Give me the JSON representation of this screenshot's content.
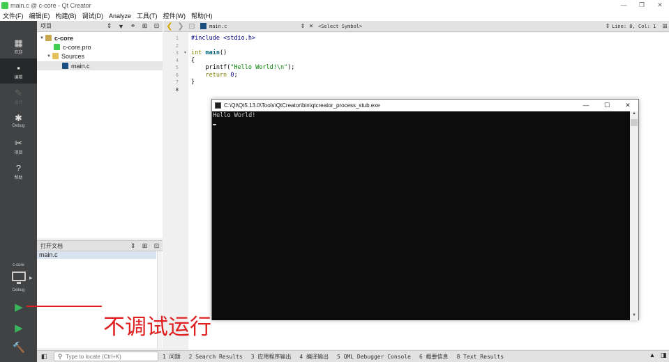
{
  "window": {
    "title": "main.c @ c-core - Qt Creator",
    "controls": [
      "—",
      "❐",
      "✕"
    ]
  },
  "menu": [
    "文件(F)",
    "编辑(E)",
    "构建(B)",
    "调试(D)",
    "Analyze",
    "工具(T)",
    "控件(W)",
    "帮助(H)"
  ],
  "modes": [
    {
      "label": "欢迎",
      "icon": "grid-icon"
    },
    {
      "label": "编辑",
      "icon": "edit-icon"
    },
    {
      "label": "设计",
      "icon": "pen-icon"
    },
    {
      "label": "Debug",
      "icon": "bug-icon"
    },
    {
      "label": "项目",
      "icon": "wrench-icon"
    },
    {
      "label": "帮助",
      "icon": "help-icon"
    }
  ],
  "kit": {
    "project": "c-core",
    "config": "Debug"
  },
  "project_pane": {
    "title": "项目",
    "tree": [
      {
        "name": "c-core",
        "level": 0,
        "expanded": true
      },
      {
        "name": "c-core.pro",
        "level": 1
      },
      {
        "name": "Sources",
        "level": 1,
        "expanded": true
      },
      {
        "name": "main.c",
        "level": 2,
        "selected": true
      }
    ]
  },
  "open_docs": {
    "title": "打开文档",
    "items": [
      "main.c"
    ]
  },
  "editor": {
    "file": "main.c",
    "symbol": "<Select Symbol>",
    "position": "Line: 8, Col: 1",
    "line_numbers": [
      "1",
      "2",
      "3",
      "4",
      "5",
      "6",
      "7",
      "8"
    ],
    "code": [
      "#include <stdio.h>",
      "",
      "int main()",
      "{",
      "    printf(\"Hello World!\\n\");",
      "    return 0;",
      "}",
      ""
    ]
  },
  "console": {
    "title": "C:\\Qt\\Qt5.13.0\\Tools\\QtCreator\\bin\\qtcreator_process_stub.exe",
    "output": "Hello World!"
  },
  "annotation": "不调试运行",
  "statusbar": {
    "locator_placeholder": "Type to locate (Ctrl+K)",
    "panes": [
      "1 问题",
      "2 Search Results",
      "3 应用程序输出",
      "4 编译输出",
      "5 QML Debugger Console",
      "6 概要信息",
      "8 Text Results"
    ]
  },
  "colors": {
    "modebar": "#404244",
    "run": "#3ab55e",
    "annotation": "#e02020"
  }
}
